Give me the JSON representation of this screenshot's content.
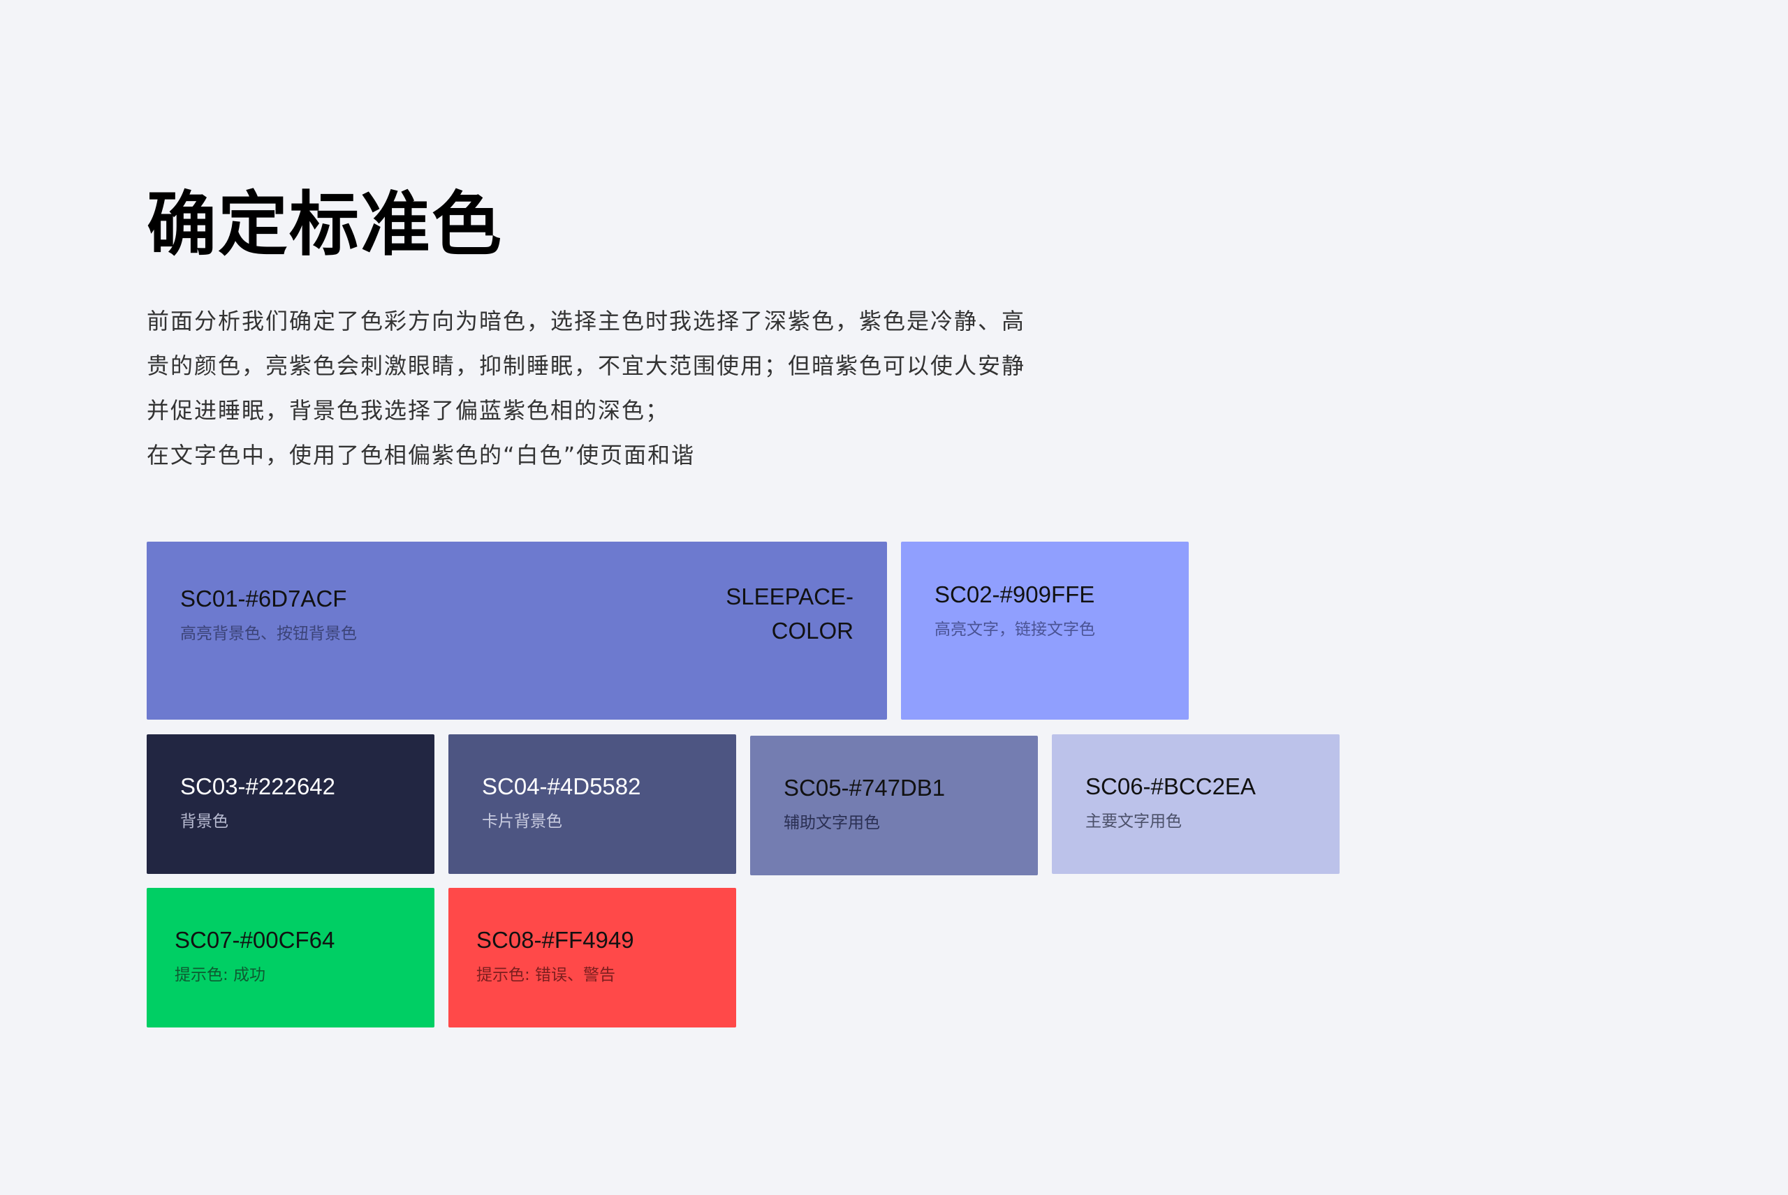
{
  "title": "确定标准色",
  "description": [
    "前面分析我们确定了色彩方向为暗色，选择主色时我选择了深紫色，紫色是冷静、高",
    "贵的颜色，亮紫色会刺激眼睛，抑制睡眠，不宜大范围使用；但暗紫色可以使人安静",
    "并促进睡眠，背景色我选择了偏蓝紫色相的深色；",
    "在文字色中，使用了色相偏紫色的“白色”使页面和谐"
  ],
  "swatches": [
    {
      "code": "SC01-#6D7ACF",
      "usage": "高亮背景色、按钮背景色",
      "extra": "SLEEPACE-\nCOLOR",
      "color": "#6D7ACF",
      "text_color": "#111111",
      "usage_color": "#3B4377"
    },
    {
      "code": "SC02-#909FFE",
      "usage": "高亮文字，链接文字色",
      "color": "#909FFE",
      "text_color": "#111111",
      "usage_color": "#4A5394"
    },
    {
      "code": "SC03-#222642",
      "usage": "背景色",
      "color": "#222642",
      "text_color": "#FFFFFF",
      "usage_color": "#B9BCD2"
    },
    {
      "code": "SC04-#4D5582",
      "usage": "卡片背景色",
      "color": "#4D5582",
      "text_color": "#FFFFFF",
      "usage_color": "#C9CCE0"
    },
    {
      "code": "SC05-#747DB1",
      "usage": "辅助文字用色",
      "color": "#747DB1",
      "text_color": "#111111",
      "usage_color": "#2A2F52"
    },
    {
      "code": "SC06-#BCC2EA",
      "usage": "主要文字用色",
      "color": "#BCC2EA",
      "text_color": "#111111",
      "usage_color": "#4B5069"
    },
    {
      "code": "SC07-#00CF64",
      "usage": "提示色: 成功",
      "color": "#00CF64",
      "text_color": "#111111",
      "usage_color": "#0E5A31"
    },
    {
      "code": "SC08-#FF4949",
      "usage": "提示色: 错误、警告",
      "color": "#FF4949",
      "text_color": "#111111",
      "usage_color": "#7A1E1E"
    }
  ],
  "colors": {
    "background": "#F3F4F8",
    "title": "#000000",
    "body_text": "#333333"
  }
}
